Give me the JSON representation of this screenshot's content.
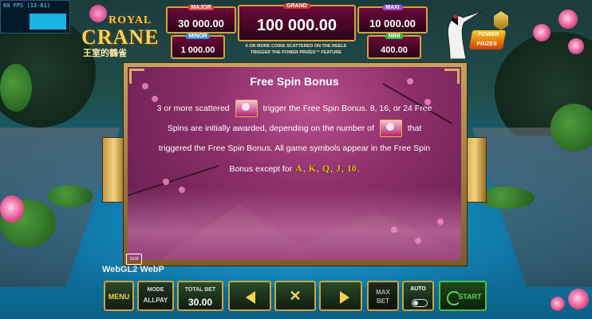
{
  "fps": {
    "label": "60 FPS (13-61)"
  },
  "logo": {
    "royal": "ROYAL",
    "crane": "CRANE",
    "chinese": "王室的鶴雀"
  },
  "jackpots": {
    "major": {
      "label": "MAJOR",
      "value": "30 000.00",
      "color": "#d9443a"
    },
    "minor": {
      "label": "MINOR",
      "value": "1 000.00",
      "color": "#3a8be0"
    },
    "grand": {
      "label": "GRAND",
      "value": "100 000.00",
      "color": "#d63a2a"
    },
    "maxi": {
      "label": "MAXI",
      "value": "10 000.00",
      "color": "#9c4ad9"
    },
    "mini": {
      "label": "MINI",
      "value": "400.00",
      "color": "#3ab34a"
    },
    "note_line1": "6 OR MORE COINS SCATTERED ON THE REELS",
    "note_line2": "TRIGGER THE POWER PRIZES™ FEATURE"
  },
  "power_prizes": {
    "label": "POWER PRIZES"
  },
  "panel": {
    "title": "Free Spin Bonus",
    "text_a": "3 or more scattered",
    "text_b": "trigger the Free Spin Bonus. 8, 16, or 24 Free",
    "text_c": "Spins are initially awarded, depending on the number of",
    "text_d": "that",
    "text_e": "triggered the Free Spin Bonus. All game symbols appear in the Free Spin",
    "text_f": "Bonus except for",
    "excluded_symbols": [
      "A",
      "K",
      "Q",
      "J",
      "10"
    ],
    "small_logo": "OLM"
  },
  "footer": {
    "webgl": "WebGL2  WebP",
    "menu": "MENU",
    "mode_label": "MODE",
    "mode_value": "ALLPAY",
    "total_bet_label": "TOTAL BET",
    "total_bet_value": "30.00",
    "max_bet_line1": "MAX",
    "max_bet_line2": "BET",
    "auto": "AUTO",
    "start": "START"
  },
  "icons": [
    "chevron-left-icon",
    "close-icon",
    "chevron-right-icon",
    "toggle-icon",
    "refresh-icon"
  ],
  "colors": {
    "accent_gold": "#f5d24a",
    "panel_purple": "#8b2d69",
    "frame_gold": "#c9a25d"
  }
}
